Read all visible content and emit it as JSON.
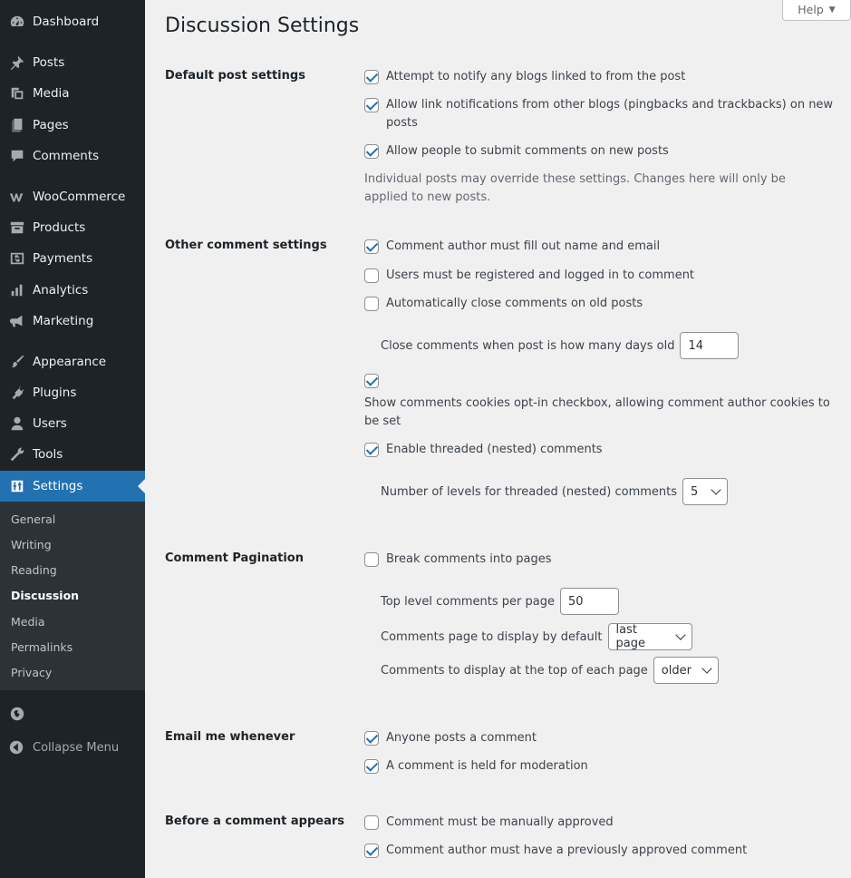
{
  "sidebar": {
    "items": [
      {
        "label": "Dashboard",
        "icon": "dashboard-icon"
      },
      {
        "label": "Posts",
        "icon": "pin-icon"
      },
      {
        "label": "Media",
        "icon": "media-icon"
      },
      {
        "label": "Pages",
        "icon": "pages-icon"
      },
      {
        "label": "Comments",
        "icon": "comment-icon"
      },
      {
        "label": "WooCommerce",
        "icon": "woocommerce-icon"
      },
      {
        "label": "Products",
        "icon": "archive-icon"
      },
      {
        "label": "Payments",
        "icon": "dollar-icon"
      },
      {
        "label": "Analytics",
        "icon": "bar-chart-icon"
      },
      {
        "label": "Marketing",
        "icon": "megaphone-icon"
      },
      {
        "label": "Appearance",
        "icon": "paintbrush-icon"
      },
      {
        "label": "Plugins",
        "icon": "plug-icon"
      },
      {
        "label": "Users",
        "icon": "user-icon"
      },
      {
        "label": "Tools",
        "icon": "wrench-icon"
      },
      {
        "label": "Settings",
        "icon": "settings-icon"
      }
    ],
    "submenu": [
      "General",
      "Writing",
      "Reading",
      "Discussion",
      "Media",
      "Permalinks",
      "Privacy"
    ],
    "collapse_label": "Collapse Menu"
  },
  "header": {
    "help_label": "Help",
    "title": "Discussion Settings"
  },
  "sections": {
    "default_post": {
      "label": "Default post settings",
      "options": [
        {
          "text": "Attempt to notify any blogs linked to from the post",
          "checked": true
        },
        {
          "text": "Allow link notifications from other blogs (pingbacks and trackbacks) on new posts",
          "checked": true
        },
        {
          "text": "Allow people to submit comments on new posts",
          "checked": true
        }
      ],
      "description": "Individual posts may override these settings. Changes here will only be applied to new posts."
    },
    "other_comment": {
      "label": "Other comment settings",
      "options": [
        {
          "text": "Comment author must fill out name and email",
          "checked": true
        },
        {
          "text": "Users must be registered and logged in to comment",
          "checked": false
        },
        {
          "text": "Automatically close comments on old posts",
          "checked": false
        }
      ],
      "close_days_label": "Close comments when post is how many days old",
      "close_days_value": "14",
      "cookies_checked": true,
      "cookies_text": "Show comments cookies opt-in checkbox, allowing comment author cookies to be set",
      "threaded_text": "Enable threaded (nested) comments",
      "threaded_checked": true,
      "levels_label": "Number of levels for threaded (nested) comments",
      "levels_value": "5"
    },
    "pagination": {
      "label": "Comment Pagination",
      "break_text": "Break comments into pages",
      "break_checked": false,
      "per_page_label": "Top level comments per page",
      "per_page_value": "50",
      "default_page_label": "Comments page to display by default",
      "default_page_value": "last page",
      "top_label": "Comments to display at the top of each page",
      "top_value": "older"
    },
    "email": {
      "label": "Email me whenever",
      "options": [
        {
          "text": "Anyone posts a comment",
          "checked": true
        },
        {
          "text": "A comment is held for moderation",
          "checked": true
        }
      ]
    },
    "before_appears": {
      "label": "Before a comment appears",
      "options": [
        {
          "text": "Comment must be manually approved",
          "checked": false
        },
        {
          "text": "Comment author must have a previously approved comment",
          "checked": true
        }
      ]
    }
  },
  "colors": {
    "sidebar_bg": "#1d2327",
    "accent": "#2271b1",
    "page_bg": "#f0f0f1"
  }
}
